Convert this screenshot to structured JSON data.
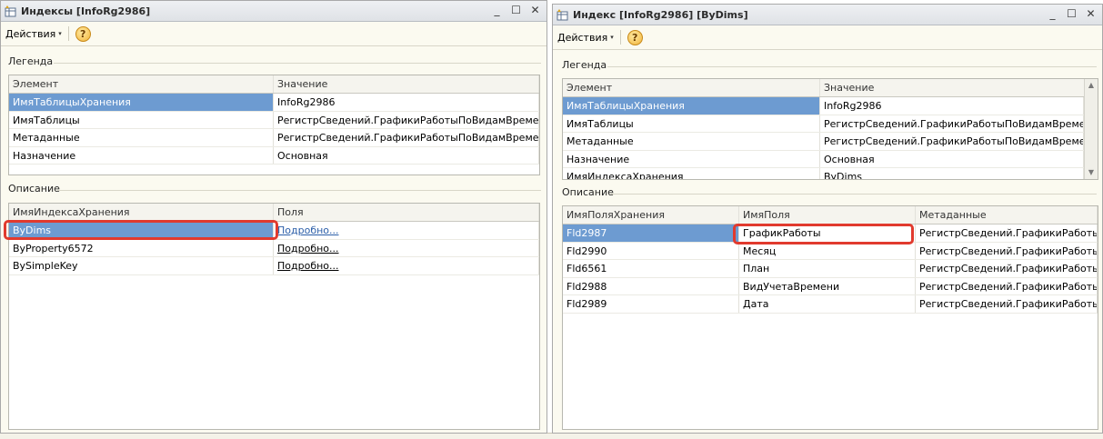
{
  "window1": {
    "title": "Индексы [InfoRg2986]",
    "toolbar": {
      "actions_label": "Действия",
      "actions_arrow": "▾",
      "help_label": "?"
    },
    "legend": {
      "section_label": "Легенда",
      "columns": [
        "Элемент",
        "Значение"
      ],
      "rows": [
        [
          "ИмяТаблицыХранения",
          "InfoRg2986"
        ],
        [
          "ИмяТаблицы",
          "РегистрСведений.ГрафикиРаботыПоВидамВремени"
        ],
        [
          "Метаданные",
          "РегистрСведений.ГрафикиРаботыПоВидамВремени"
        ],
        [
          "Назначение",
          "Основная"
        ]
      ]
    },
    "description": {
      "section_label": "Описание",
      "columns": [
        "ИмяИндексаХранения",
        "Поля"
      ],
      "rows": [
        [
          "ByDims",
          "Подробно..."
        ],
        [
          "ByProperty6572",
          "Подробно..."
        ],
        [
          "BySimpleKey",
          "Подробно..."
        ]
      ]
    }
  },
  "window2": {
    "title": "Индекс [InfoRg2986] [ByDims]",
    "toolbar": {
      "actions_label": "Действия",
      "actions_arrow": "▾",
      "help_label": "?"
    },
    "legend": {
      "section_label": "Легенда",
      "columns": [
        "Элемент",
        "Значение"
      ],
      "rows": [
        [
          "ИмяТаблицыХранения",
          "InfoRg2986"
        ],
        [
          "ИмяТаблицы",
          "РегистрСведений.ГрафикиРаботыПоВидамВремени"
        ],
        [
          "Метаданные",
          "РегистрСведений.ГрафикиРаботыПоВидамВремени"
        ],
        [
          "Назначение",
          "Основная"
        ],
        [
          "ИмяИндексаХранения",
          "ByDims"
        ]
      ]
    },
    "description": {
      "section_label": "Описание",
      "columns": [
        "ИмяПоляХранения",
        "ИмяПоля",
        "Метаданные"
      ],
      "rows": [
        [
          "Fld2987",
          "ГрафикРаботы",
          "РегистрСведений.ГрафикиРаботы..."
        ],
        [
          "Fld2990",
          "Месяц",
          "РегистрСведений.ГрафикиРаботы..."
        ],
        [
          "Fld6561",
          "План",
          "РегистрСведений.ГрафикиРаботы..."
        ],
        [
          "Fld2988",
          "ВидУчетаВремени",
          "РегистрСведений.ГрафикиРаботы..."
        ],
        [
          "Fld2989",
          "Дата",
          "РегистрСведений.ГрафикиРаботы..."
        ]
      ]
    }
  },
  "window_controls": {
    "minimize": "_",
    "maximize": "☐",
    "close": "✕"
  },
  "colors": {
    "selection": "#6d9bd1",
    "highlight": "#e13a2e"
  },
  "icons": [
    "table-icon",
    "chevron-down-icon",
    "help-icon",
    "minimize-icon",
    "maximize-icon",
    "close-icon"
  ]
}
